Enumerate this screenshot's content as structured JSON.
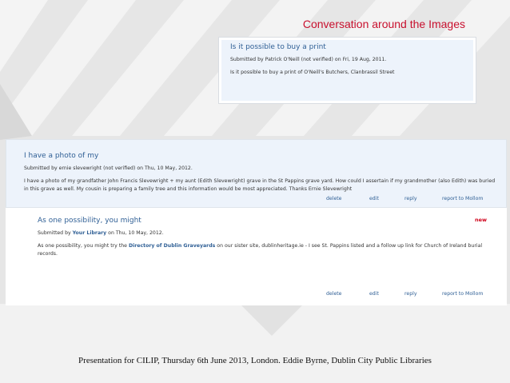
{
  "slide": {
    "title": "Conversation around the Images",
    "footer": "Presentation for CILIP, Thursday 6th June 2013, London. Eddie Byrne, Dublin City Public Libraries"
  },
  "top_comment": {
    "title": "Is it possible to buy a print",
    "submitted": "Submitted by Patrick O'Neill (not verified) on Fri, 19 Aug, 2011.",
    "body": "Is it possible to buy a print of O'Neill's Butchers, Clanbrassil Street"
  },
  "comment1": {
    "title": "I have a photo of my",
    "submitted": "Submitted by ernie slevewright (not verified) on Thu, 10 May, 2012.",
    "body": "I have a photo of my grandfather John Francis Slevewright + my aunt (Edith Slevewright) grave in the St Pappins grave yard. How could I assertain if my grandmother (also Edith) was buried in this grave as well. My cousin is preparing a family tree and this information would be most appreciated. Thanks Ernie Slevewright",
    "actions": {
      "delete": "delete",
      "edit": "edit",
      "reply": "reply",
      "report": "report to Mollom"
    }
  },
  "comment2": {
    "title": "As one possibility, you might",
    "badge": "new",
    "submitted_prefix": "Submitted by ",
    "submitted_author": "Your Library",
    "submitted_suffix": " on Thu, 10 May, 2012.",
    "body_part1": "As one possibility, you might try the ",
    "body_link": "Directory of Dublin Graveyards",
    "body_part2": " on our sister site, dublinheritage.ie - I see St. Pappins listed and a follow up link for Church of Ireland burial records.",
    "actions": {
      "delete": "delete",
      "edit": "edit",
      "reply": "reply",
      "report": "report to Mollom"
    }
  },
  "colors": {
    "accent": "#c8102e",
    "link": "#2f5f95",
    "panel_bg": "#edf3fb",
    "new": "#d0021b"
  }
}
